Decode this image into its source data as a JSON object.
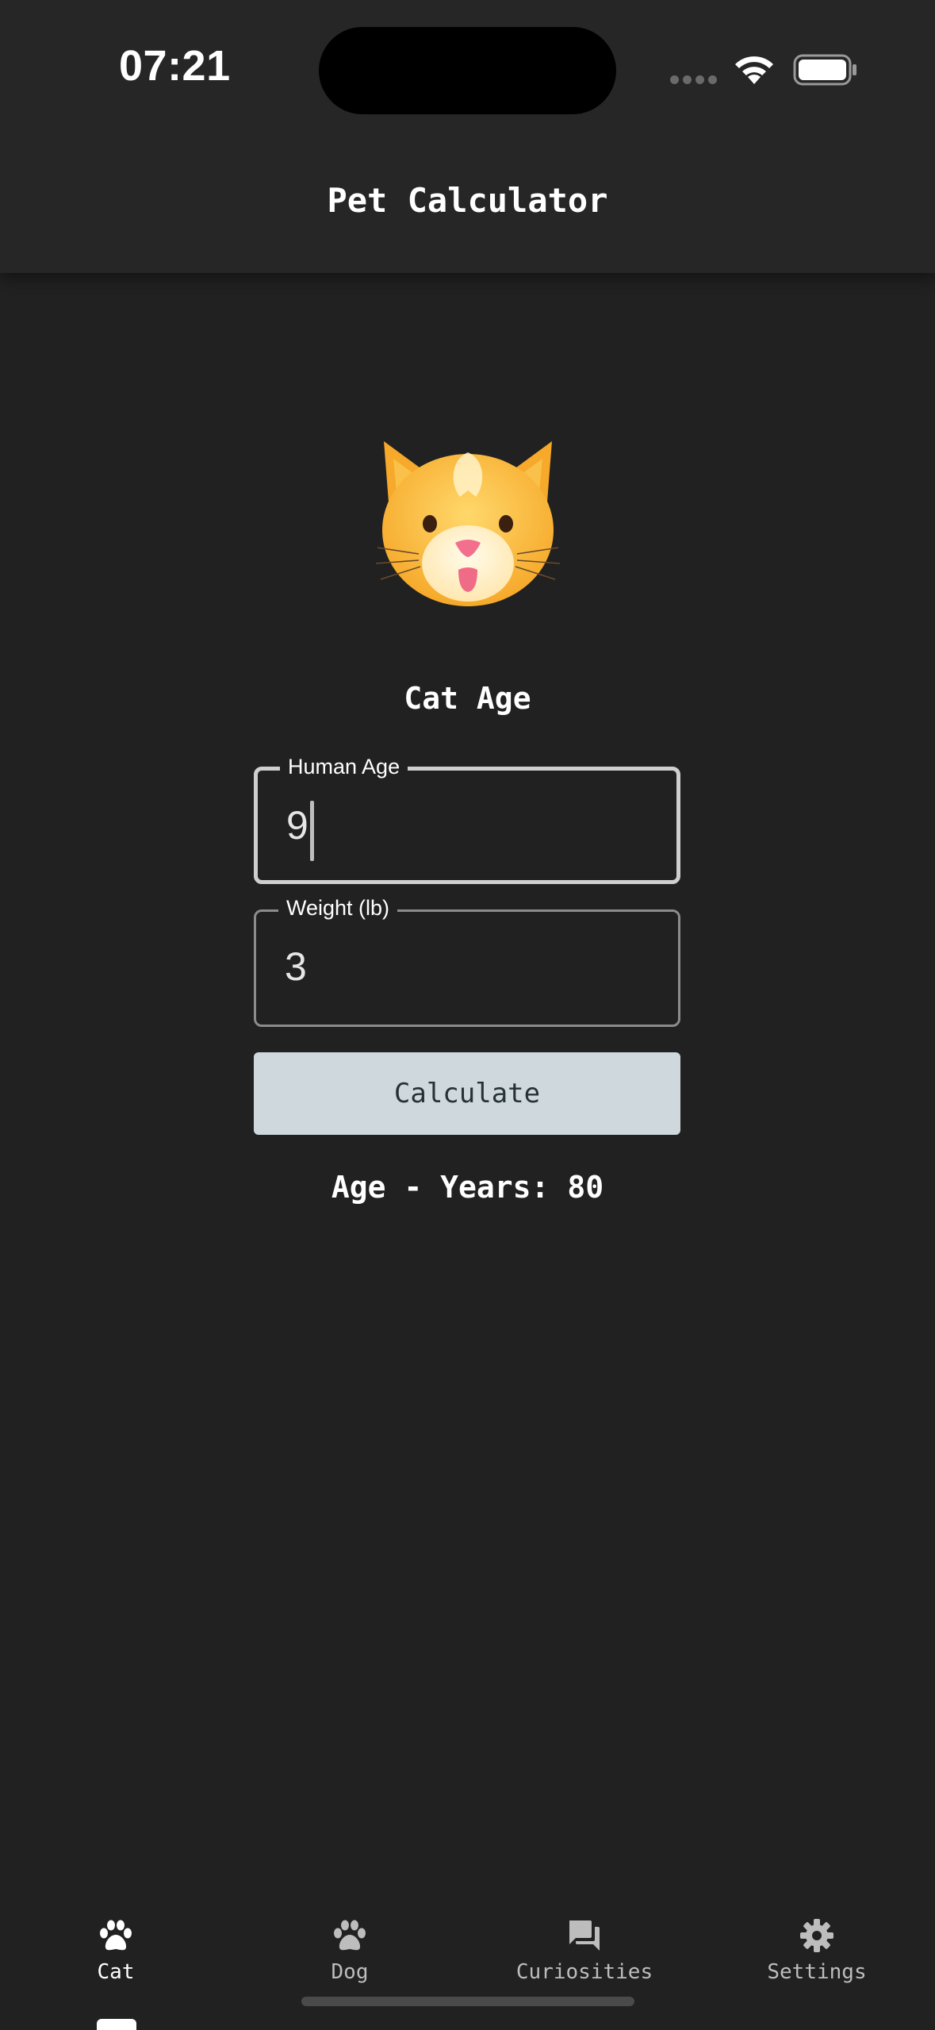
{
  "status_bar": {
    "time": "07:21"
  },
  "app_bar": {
    "title": "Pet Calculator"
  },
  "main": {
    "image_icon": "cat-face-icon",
    "section_title": "Cat Age",
    "fields": [
      {
        "label": "Human Age",
        "value": "9",
        "focused": true
      },
      {
        "label": "Weight (lb)",
        "value": "3",
        "focused": false
      }
    ],
    "calculate_label": "Calculate",
    "result_text": "Age - Years: 80"
  },
  "bottom_nav": {
    "items": [
      {
        "label": "Cat",
        "icon": "paw-icon",
        "active": true
      },
      {
        "label": "Dog",
        "icon": "paw-icon",
        "active": false
      },
      {
        "label": "Curiosities",
        "icon": "forum-icon",
        "active": false
      },
      {
        "label": "Settings",
        "icon": "gear-icon",
        "active": false
      }
    ]
  },
  "colors": {
    "background": "#212121",
    "app_bar": "#262626",
    "button": "#cfd8dc",
    "button_text": "#263238",
    "nav_inactive": "#bdbdbd"
  }
}
